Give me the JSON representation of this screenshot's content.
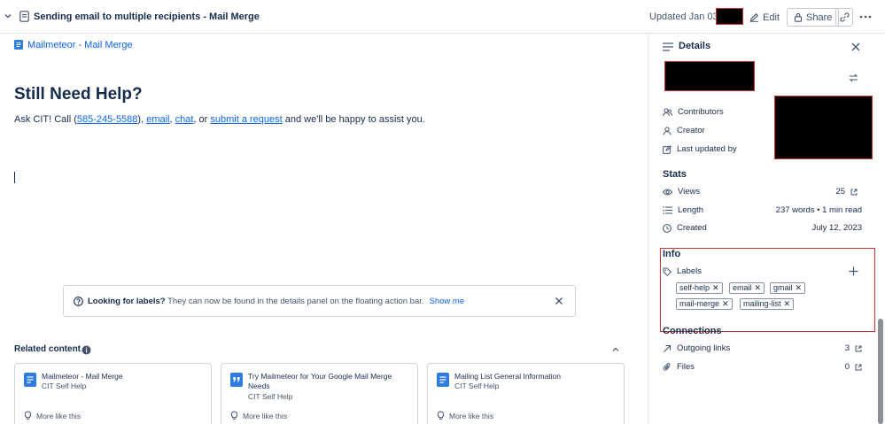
{
  "topbar": {
    "title": "Sending email to multiple recipients - Mail Merge",
    "updated": "Updated Jan 03",
    "edit_label": "Edit",
    "share_label": "Share"
  },
  "page": {
    "breadcrumb_link": "Mailmeteor - Mail Merge",
    "heading": "Still Need Help?",
    "para_prefix": "Ask CIT! Call (",
    "phone": "585-245-5588",
    "para_sep1": "), ",
    "email_link": "email",
    "para_sep2": ", ",
    "chat_link": "chat",
    "para_sep3": ", or ",
    "request_link": "submit a request",
    "para_suffix": " and we'll be happy to assist you."
  },
  "notice": {
    "bold": "Looking for labels?",
    "text": " They can now be found in the details panel on the floating action bar.",
    "link": "Show me"
  },
  "related": {
    "title": "Related content",
    "more_label": "More like this",
    "cards": [
      {
        "title": "Mailmeteor - Mail Merge",
        "space": "CIT Self Help"
      },
      {
        "title": "Try Mailmeteor for Your Google Mail Merge Needs",
        "space": "CIT Self Help"
      },
      {
        "title": "Mailing List General Information",
        "space": "CIT Self Help"
      }
    ]
  },
  "details": {
    "title": "Details",
    "contributors_label": "Contributors",
    "creator_label": "Creator",
    "last_updated_label": "Last updated by",
    "stats_title": "Stats",
    "views_label": "Views",
    "views_value": "25",
    "length_label": "Length",
    "length_value": "237 words • 1 min read",
    "created_label": "Created",
    "created_value": "July 12, 2023",
    "info_title": "Info",
    "labels_label": "Labels",
    "labels": [
      "self-help",
      "email",
      "gmail",
      "mail-merge",
      "mailing-list"
    ],
    "connections_title": "Connections",
    "outgoing_label": "Outgoing links",
    "outgoing_value": "3",
    "files_label": "Files",
    "files_value": "0"
  },
  "colors": {
    "link": "#0c66e4",
    "text": "#172b4d",
    "subtle": "#44546f",
    "highlight_border": "#c9372c",
    "doc_icon": "#2f7ce0"
  }
}
